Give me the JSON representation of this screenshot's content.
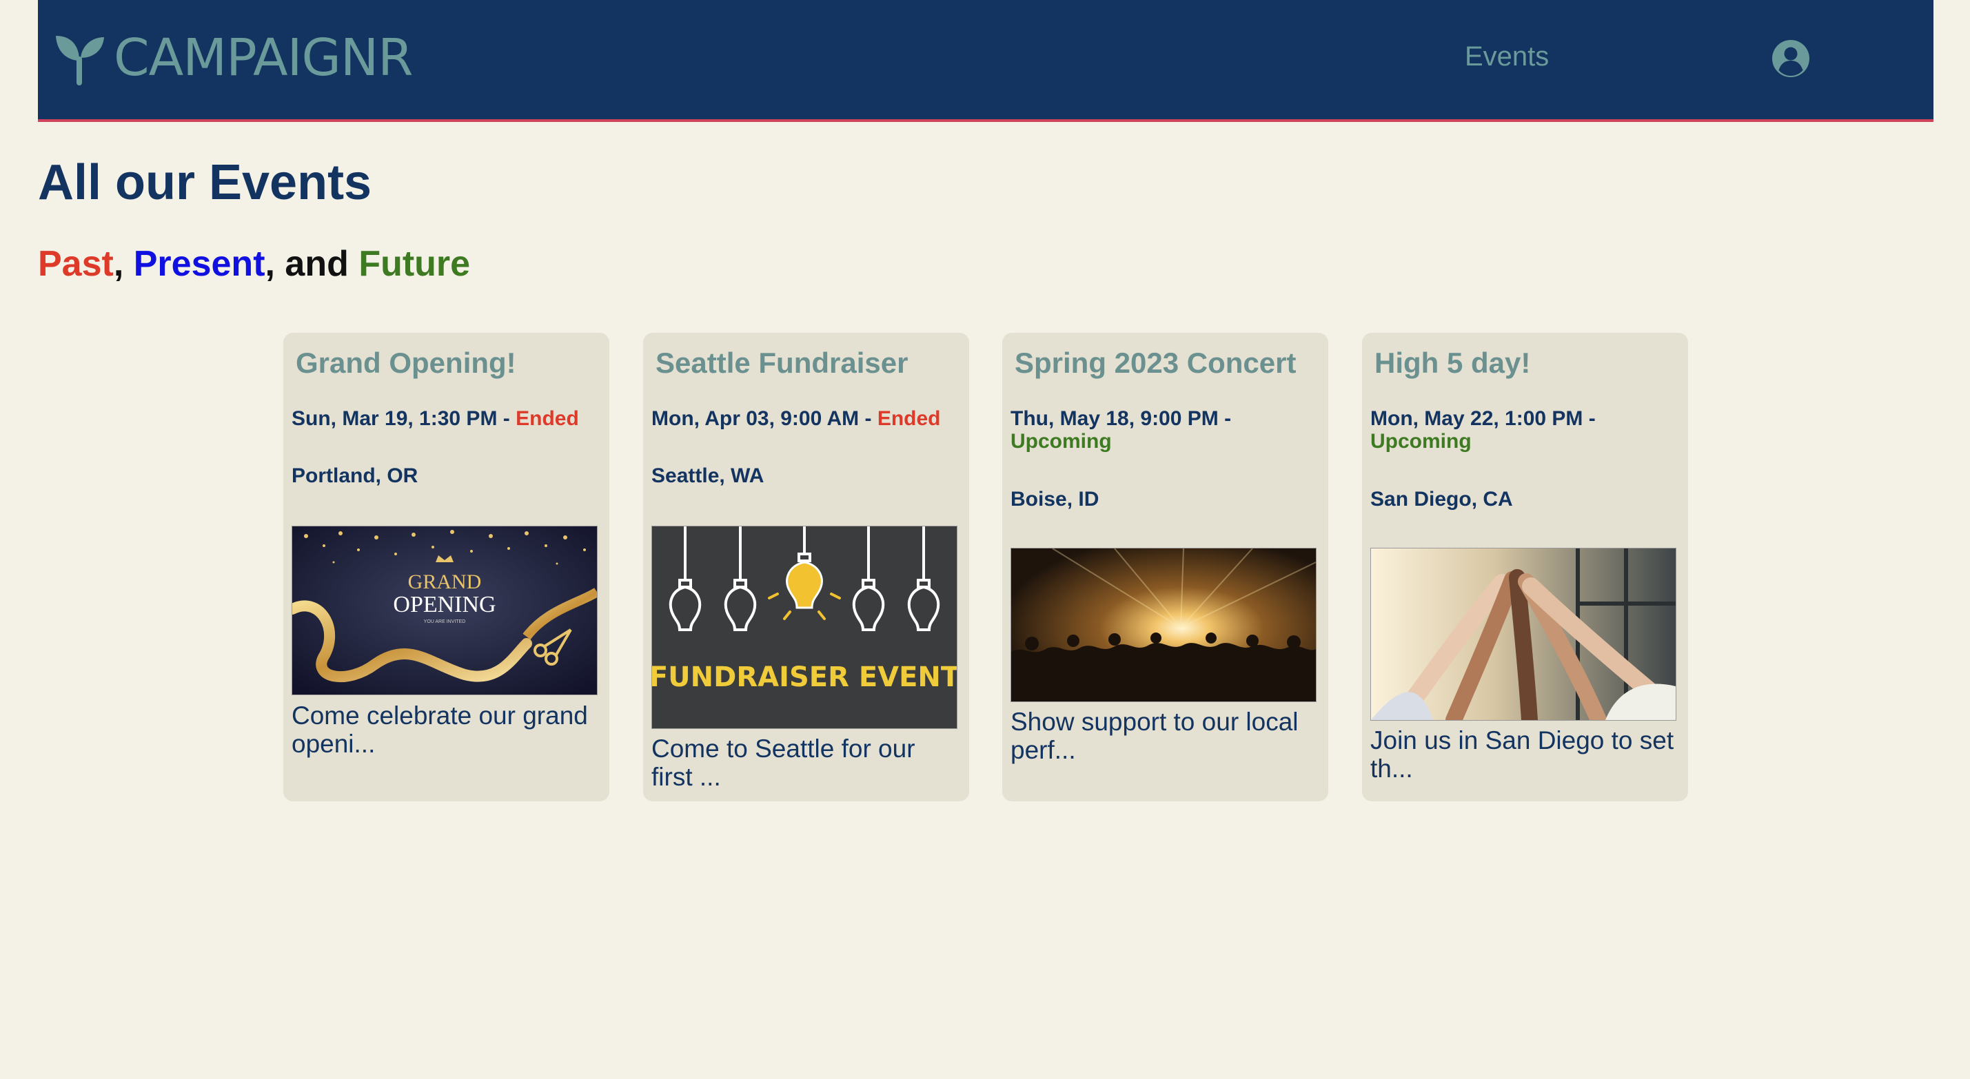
{
  "app": {
    "brand": "CAMPAIGNR",
    "nav": {
      "events_label": "Events"
    }
  },
  "page": {
    "title": "All our Events",
    "subtitle": {
      "past": "Past",
      "sep1": ",",
      "present": "Present",
      "sep2": ", and",
      "future": "Future"
    }
  },
  "colors": {
    "navbar_bg": "#133460",
    "navbar_accent": "#d0415a",
    "brand_teal": "#6a9a9a",
    "page_bg": "#f4f1e6",
    "card_bg": "#e4e0d2",
    "status_ended": "#dd3a2a",
    "status_upcoming": "#3d7a22",
    "present_blue": "#1010e0"
  },
  "events": [
    {
      "title": "Grand Opening!",
      "date": "Sun, Mar 19, 1:30 PM -",
      "status": "Ended",
      "location": "Portland, OR",
      "image_text_1": "GRAND",
      "image_text_2": "OPENING",
      "image_text_3": "YOU ARE INVITED",
      "description": "Come celebrate our grand openi..."
    },
    {
      "title": "Seattle Fundraiser",
      "date": "Mon, Apr 03, 9:00 AM -",
      "status": "Ended",
      "location": "Seattle, WA",
      "image_text_1": "FUNDRAISER EVENT",
      "description": "Come to Seattle for our first ..."
    },
    {
      "title": "Spring 2023 Concert",
      "date": "Thu, May 18, 9:00 PM -",
      "status": "Upcoming",
      "location": "Boise, ID",
      "description": "Show support to our local perf..."
    },
    {
      "title": "High 5 day!",
      "date": "Mon, May 22, 1:00 PM -",
      "status": "Upcoming",
      "location": "San Diego, CA",
      "description": "Join us in San Diego to set th..."
    }
  ]
}
